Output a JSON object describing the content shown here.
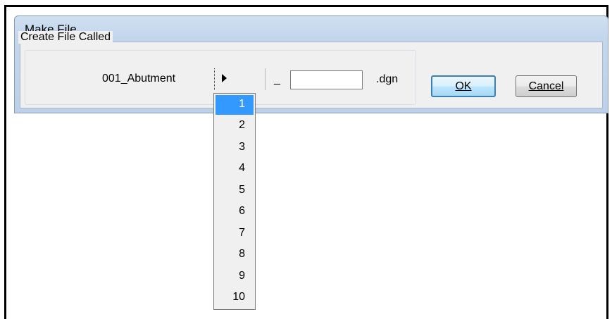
{
  "dialog": {
    "title": "Make File",
    "group_label": "Create File Called",
    "prefix": "001_Abutment",
    "separator": "_",
    "suffix_value": "",
    "extension": ".dgn",
    "ok_label": "OK",
    "cancel_label": "Cancel"
  },
  "dropdown": {
    "selected": "1",
    "items": [
      "1",
      "2",
      "3",
      "4",
      "5",
      "6",
      "7",
      "8",
      "9",
      "10"
    ]
  },
  "colors": {
    "selection": "#3399ff",
    "titlebar": "#c3d6ec"
  },
  "icons": {
    "dropdown_arrow": "triangle-right-icon"
  }
}
